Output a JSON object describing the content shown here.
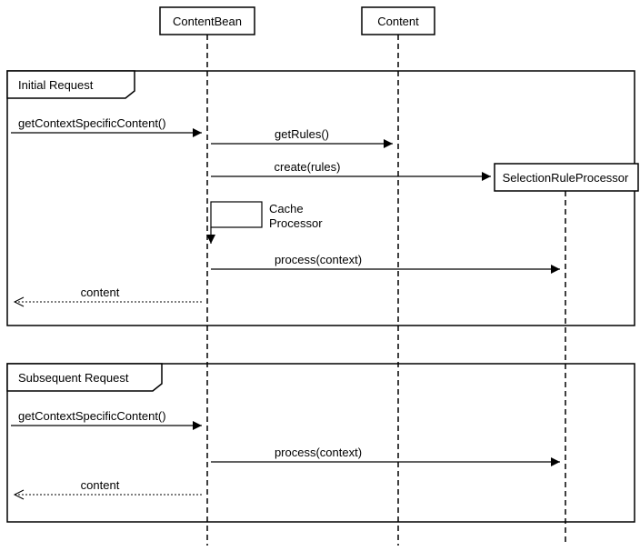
{
  "participants": {
    "p1": "ContentBean",
    "p2": "Content",
    "p3": "SelectionRuleProcessor"
  },
  "frames": {
    "f1": "Initial Request",
    "f2": "Subsequent Request"
  },
  "messages": {
    "m1": "getContextSpecificContent()",
    "m2": "getRules()",
    "m3": "create(rules)",
    "m4a": "Cache",
    "m4b": "Processor",
    "m5": "process(context)",
    "r1": "content",
    "m6": "getContextSpecificContent()",
    "m7": "process(context)",
    "r2": "content"
  }
}
